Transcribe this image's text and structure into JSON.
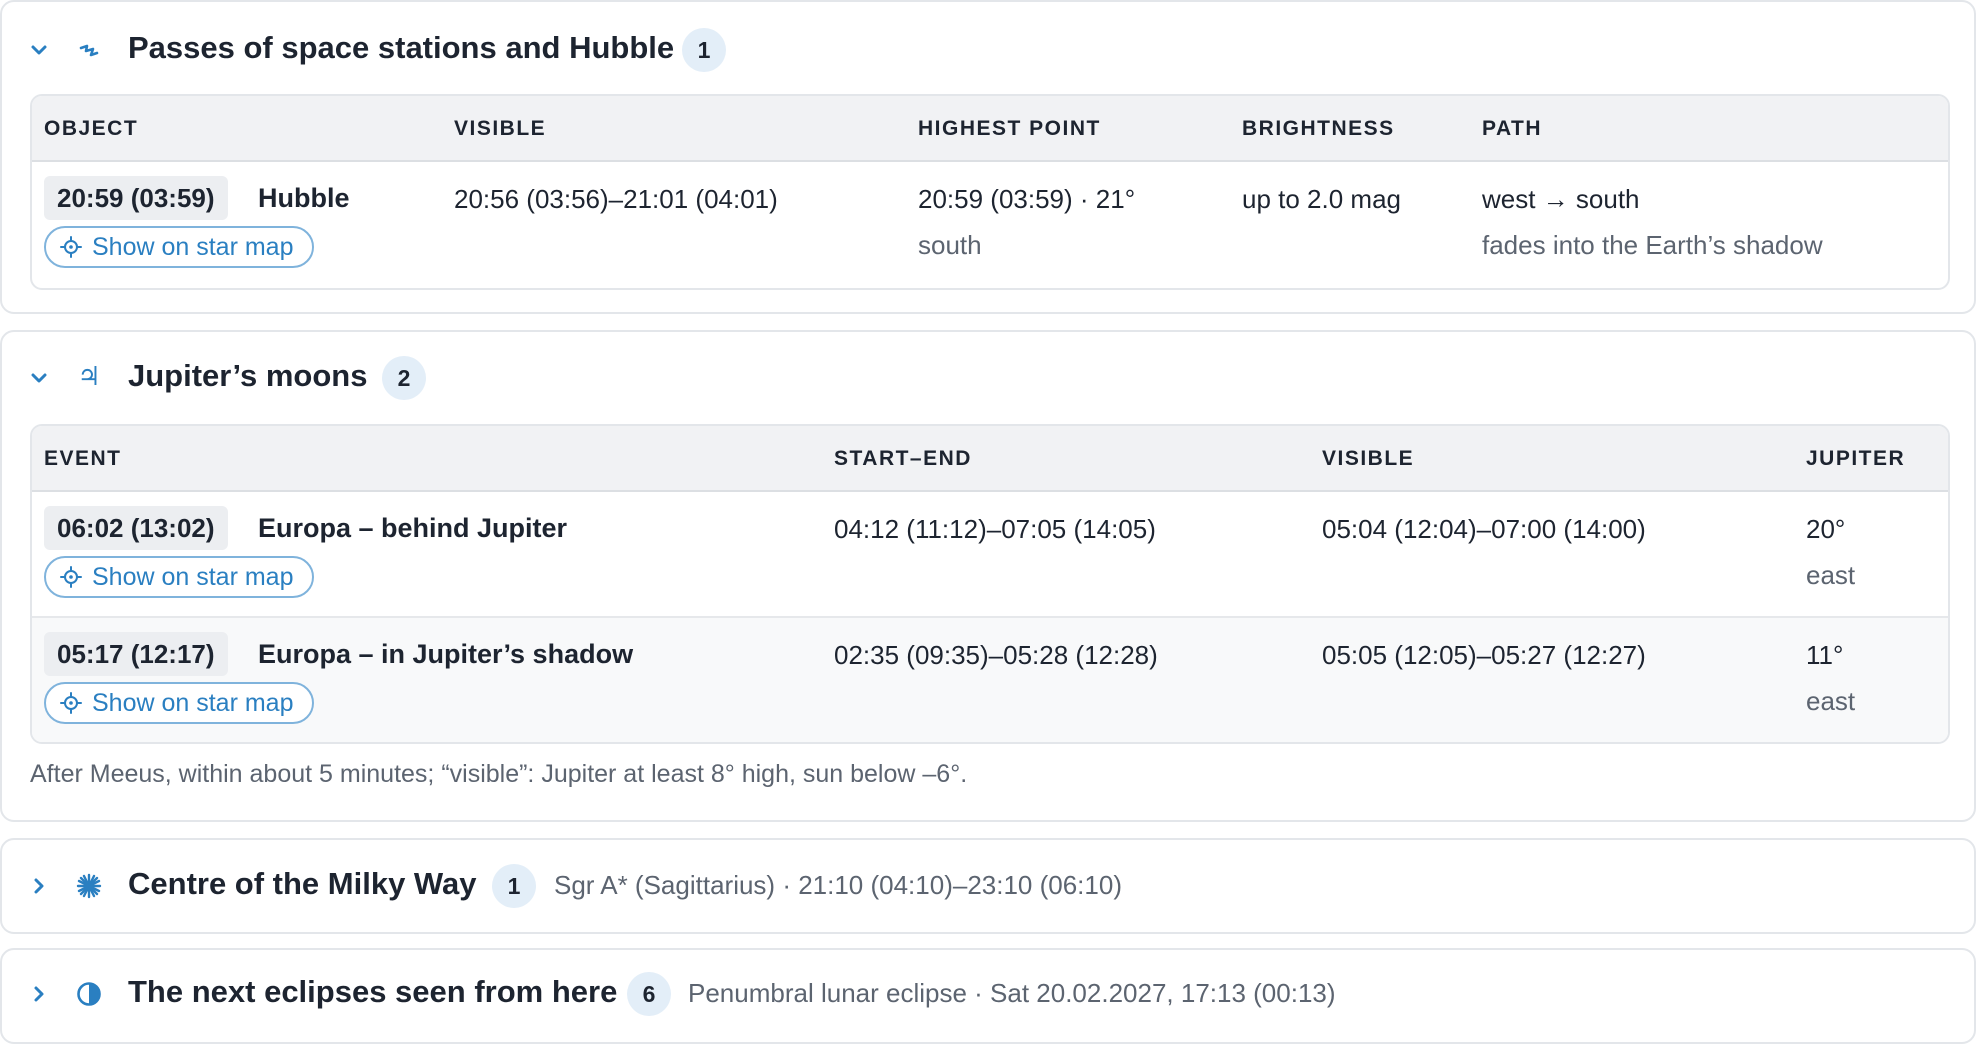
{
  "sections": {
    "passes": {
      "title": "Passes of space stations and Hubble",
      "count": "1",
      "icon": "satellite-icon",
      "expanded": true,
      "headers": [
        "OBJECT",
        "VISIBLE",
        "HIGHEST POINT",
        "BRIGHTNESS",
        "PATH"
      ],
      "rows": [
        {
          "time": "20:59 (03:59)",
          "object": "Hubble",
          "map_button": "Show on star map",
          "visible": "20:56 (03:56)–21:01 (04:01)",
          "highest_main": "20:59 (03:59) · 21°",
          "highest_sub": "south",
          "brightness": "up to 2.0 mag",
          "path_main": "west → south",
          "path_sub": "fades into the Earth’s shadow"
        }
      ]
    },
    "jupiter": {
      "title": "Jupiter’s moons",
      "count": "2",
      "icon": "jupiter-symbol-icon",
      "icon_glyph": "♃",
      "expanded": true,
      "headers": [
        "EVENT",
        "START–END",
        "VISIBLE",
        "JUPITER"
      ],
      "rows": [
        {
          "time": "06:02 (13:02)",
          "event": "Europa – behind Jupiter",
          "map_button": "Show on star map",
          "start_end": "04:12 (11:12)–07:05 (14:05)",
          "visible": "05:04 (12:04)–07:00 (14:00)",
          "alt": "20°",
          "dir": "east"
        },
        {
          "time": "05:17 (12:17)",
          "event": "Europa – in Jupiter’s shadow",
          "map_button": "Show on star map",
          "start_end": "02:35 (09:35)–05:28 (12:28)",
          "visible": "05:05 (12:05)–05:27 (12:27)",
          "alt": "11°",
          "dir": "east"
        }
      ],
      "note": "After Meeus, within about 5 minutes; “visible”: Jupiter at least 8° high, sun below –6°."
    },
    "milkyway": {
      "title": "Centre of the Milky Way",
      "count": "1",
      "icon": "starburst-icon",
      "expanded": false,
      "summary": "Sgr A* (Sagittarius) · 21:10 (04:10)–23:10 (06:10)"
    },
    "eclipses": {
      "title": "The next eclipses seen from here",
      "count": "6",
      "icon": "half-circle-icon",
      "expanded": false,
      "summary": "Penumbral lunar eclipse · Sat 20.02.2027, 17:13 (00:13)"
    }
  },
  "colors": {
    "accent": "#2a7fc1",
    "badge_bg": "#e3eef8",
    "header_bg": "#f1f2f4",
    "border": "#e3e6ea",
    "muted_text": "#5c6470"
  }
}
